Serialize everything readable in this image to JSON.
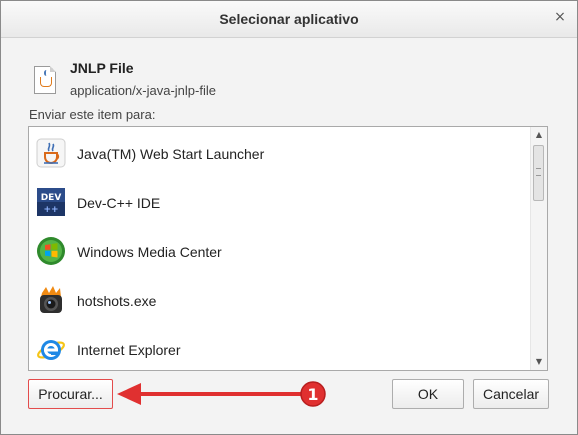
{
  "dialog": {
    "title": "Selecionar aplicativo",
    "close_glyph": "×"
  },
  "file": {
    "name": "JNLP File",
    "mime": "application/x-java-jnlp-file",
    "icon": "java-document-icon"
  },
  "send_label": "Enviar este item para:",
  "applications": [
    {
      "label": "Java(TM) Web Start Launcher",
      "icon": "java-icon"
    },
    {
      "label": "Dev-C++ IDE",
      "icon": "dev-cpp-icon"
    },
    {
      "label": "Windows Media Center",
      "icon": "windows-media-center-icon"
    },
    {
      "label": "hotshots.exe",
      "icon": "hotshots-icon"
    },
    {
      "label": "Internet Explorer",
      "icon": "internet-explorer-icon"
    }
  ],
  "buttons": {
    "browse": "Procurar...",
    "ok": "OK",
    "cancel": "Cancelar"
  },
  "annotation": {
    "marker_number": "1",
    "accent_color": "#e03030"
  },
  "colors": {
    "background": "#f3f3f3",
    "list_background": "#ffffff"
  }
}
